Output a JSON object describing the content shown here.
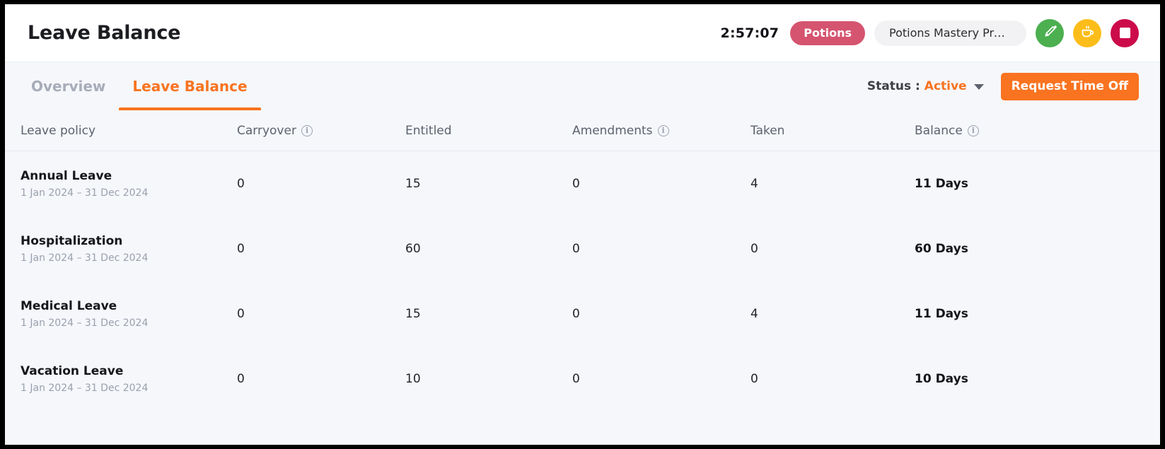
{
  "window": {
    "background": "#f5f7fb",
    "accent": "#f97320"
  },
  "topbar": {
    "app_title": "Leave Balance",
    "timer": "2:57:07",
    "project_badge": "Potions",
    "project_badge_color": "#d5546f",
    "task_pill": "Potions Mastery Progr...",
    "actions": [
      {
        "name": "edit-note-button",
        "icon": "pen-note-icon",
        "color": "#4caf50"
      },
      {
        "name": "break-button",
        "icon": "coffee-cup-icon",
        "color": "#fcbd1a"
      },
      {
        "name": "stop-timer-button",
        "icon": "stop-square-icon",
        "color": "#cc0b4a"
      }
    ]
  },
  "tabs": [
    {
      "label": "Overview",
      "active": false
    },
    {
      "label": "Leave Balance",
      "active": true
    }
  ],
  "toolbar": {
    "status_label": "Status :",
    "status_value": "Active",
    "request_button": "Request Time Off"
  },
  "table": {
    "columns": [
      {
        "label": "Leave policy",
        "info": false
      },
      {
        "label": "Carryover",
        "info": true
      },
      {
        "label": "Entitled",
        "info": false
      },
      {
        "label": "Amendments",
        "info": true
      },
      {
        "label": "Taken",
        "info": false
      },
      {
        "label": "Balance",
        "info": true
      }
    ],
    "info_glyph": "i",
    "rows": [
      {
        "policy": "Annual Leave",
        "range": "1 Jan 2024 – 31 Dec 2024",
        "carryover": "0",
        "entitled": "15",
        "amendments": "0",
        "taken": "4",
        "balance": "11 Days"
      },
      {
        "policy": "Hospitalization",
        "range": "1 Jan 2024 – 31 Dec 2024",
        "carryover": "0",
        "entitled": "60",
        "amendments": "0",
        "taken": "0",
        "balance": "60 Days"
      },
      {
        "policy": "Medical Leave",
        "range": "1 Jan 2024 – 31 Dec 2024",
        "carryover": "0",
        "entitled": "15",
        "amendments": "0",
        "taken": "4",
        "balance": "11 Days"
      },
      {
        "policy": "Vacation Leave",
        "range": "1 Jan 2024 – 31 Dec 2024",
        "carryover": "0",
        "entitled": "10",
        "amendments": "0",
        "taken": "0",
        "balance": "10 Days"
      }
    ]
  }
}
